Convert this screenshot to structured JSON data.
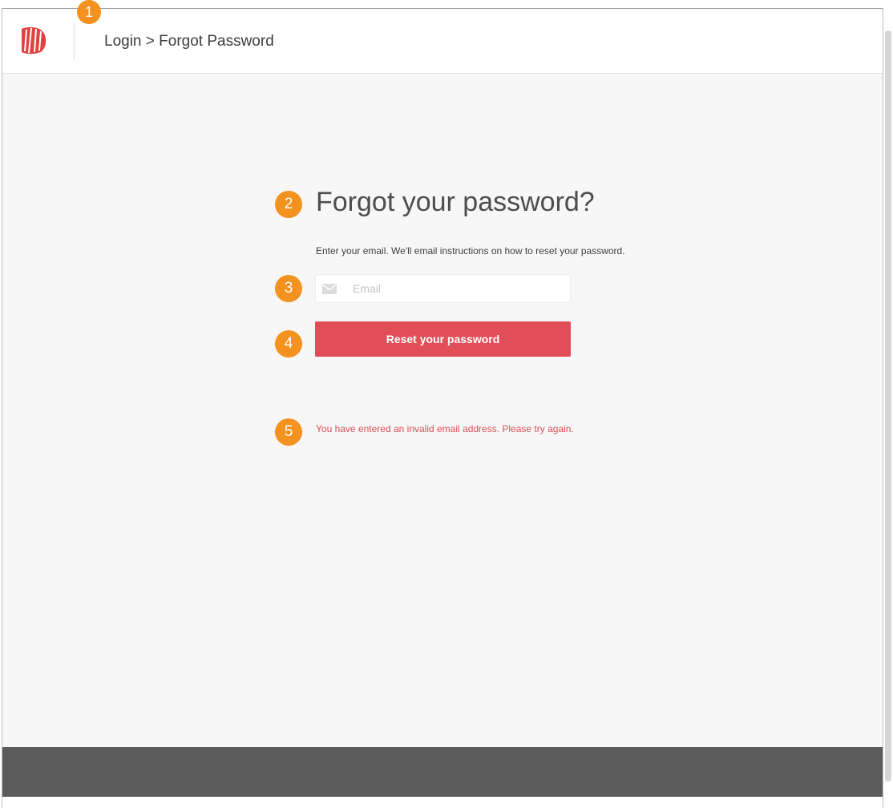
{
  "breadcrumb": {
    "text": "Login > Forgot Password"
  },
  "form": {
    "title": "Forgot your password?",
    "instructions": "Enter your email. We'll email instructions on how to reset your password.",
    "email_placeholder": "Email",
    "email_value": "",
    "submit_label": "Reset your password",
    "error_message": "You have entered an invalid email address. Please try again."
  },
  "annotations": {
    "callout_1": "1",
    "callout_2": "2",
    "callout_3": "3",
    "callout_4": "4",
    "callout_5": "5"
  },
  "icons": {
    "logo": "brand-logo",
    "email": "mail-icon"
  },
  "colors": {
    "accent": "#e24e58",
    "error": "#dd4e55",
    "callout": "#f3921f",
    "footer": "#5c5c5c",
    "page_background": "#f7f7f7"
  }
}
